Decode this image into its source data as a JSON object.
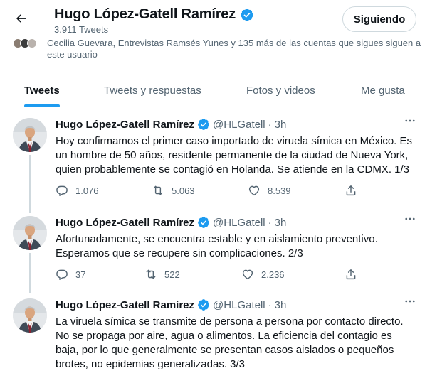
{
  "profile": {
    "name": "Hugo López-Gatell Ramírez",
    "tweet_count": "3.911 Tweets",
    "follow_button": "Siguiendo",
    "followers_you_know": "Cecilia Guevara, Entrevistas Ramsés Yunes y 135 más de las cuentas que sigues siguen a este usuario"
  },
  "tabs": [
    {
      "label": "Tweets",
      "active": true
    },
    {
      "label": "Tweets y respuestas",
      "active": false
    },
    {
      "label": "Fotos y videos",
      "active": false
    },
    {
      "label": "Me gusta",
      "active": false
    }
  ],
  "tweets": [
    {
      "author": "Hugo López-Gatell Ramírez",
      "handle": "@HLGatell",
      "separator": "·",
      "time": "3h",
      "text": "Hoy confirmamos el primer caso importado de viruela símica en México. Es un hombre de 50 años, residente permanente de la ciudad de Nueva York, quien probablemente se contagió en Holanda. Se atiende en la CDMX. 1/3",
      "replies": "1.076",
      "retweets": "5.063",
      "likes": "8.539"
    },
    {
      "author": "Hugo López-Gatell Ramírez",
      "handle": "@HLGatell",
      "separator": "·",
      "time": "3h",
      "text": "Afortunadamente, se encuentra estable y en aislamiento preventivo. Esperamos que se recupere sin complicaciones. 2/3",
      "replies": "37",
      "retweets": "522",
      "likes": "2.236"
    },
    {
      "author": "Hugo López-Gatell Ramírez",
      "handle": "@HLGatell",
      "separator": "·",
      "time": "3h",
      "text": "La viruela símica se transmite de persona a persona por contacto directo. No se propaga por aire, agua o alimentos. La eficiencia del contagio es baja, por lo que generalmente se presentan casos aislados o pequeños brotes, no epidemias generalizadas. 3/3"
    }
  ],
  "icons": {
    "back": "arrow-left-icon",
    "verified": "verified-badge-icon",
    "more": "more-horizontal-icon",
    "reply": "reply-icon",
    "retweet": "retweet-icon",
    "like": "heart-icon",
    "share": "share-icon"
  },
  "colors": {
    "accent": "#1d9bf0",
    "text_primary": "#0f1419",
    "text_secondary": "#536471",
    "border": "#eff3f4"
  }
}
